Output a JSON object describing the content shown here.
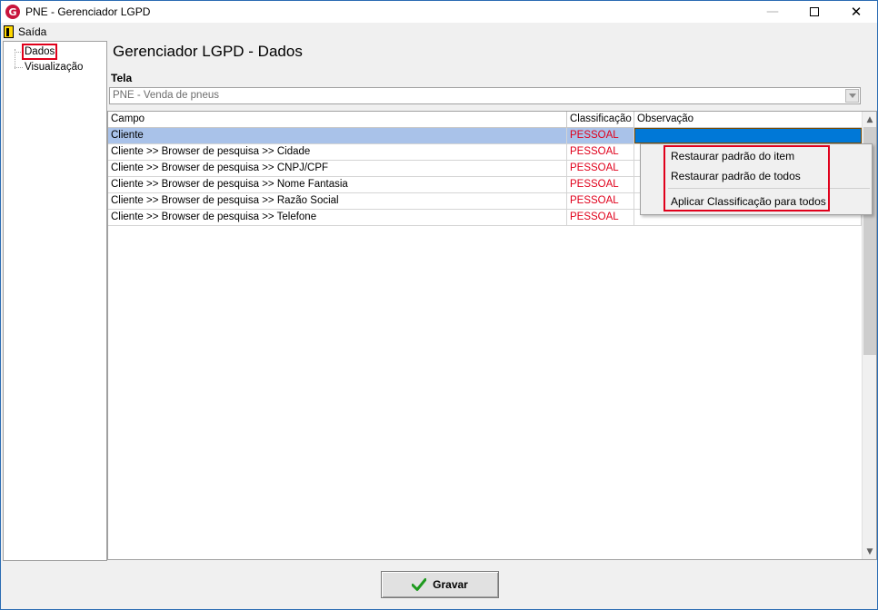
{
  "window": {
    "title": "PNE - Gerenciador LGPD",
    "app_icon_letter": "G",
    "minimize_glyph": "—",
    "close_glyph": "✕"
  },
  "menu": {
    "exit_label": "Saída"
  },
  "tree": {
    "items": [
      {
        "label": "Dados",
        "selected": true
      },
      {
        "label": "Visualização",
        "selected": false
      }
    ]
  },
  "main": {
    "title": "Gerenciador LGPD - Dados",
    "screen_label": "Tela",
    "screen_value": "PNE - Venda de pneus"
  },
  "grid": {
    "columns": [
      "Campo",
      "Classificação",
      "Observação"
    ],
    "rows": [
      {
        "field": "Cliente",
        "classification": "PESSOAL",
        "observation": ""
      },
      {
        "field": "Cliente >> Browser de pesquisa >> Cidade",
        "classification": "PESSOAL",
        "observation": ""
      },
      {
        "field": "Cliente >> Browser de pesquisa >> CNPJ/CPF",
        "classification": "PESSOAL",
        "observation": ""
      },
      {
        "field": "Cliente >> Browser de pesquisa >> Nome Fantasia",
        "classification": "PESSOAL",
        "observation": ""
      },
      {
        "field": "Cliente >> Browser de pesquisa >> Razão Social",
        "classification": "PESSOAL",
        "observation": ""
      },
      {
        "field": "Cliente >> Browser de pesquisa >> Telefone",
        "classification": "PESSOAL",
        "observation": ""
      }
    ],
    "scroll_up_glyph": "▲",
    "scroll_down_glyph": "▼"
  },
  "context_menu": {
    "items": [
      "Restaurar padrão do item",
      "Restaurar padrão de todos",
      "Aplicar Classificação para todos"
    ]
  },
  "footer": {
    "save_label": "Gravar"
  },
  "colors": {
    "accent": "#0078d7",
    "selected_row": "#a9c2e9",
    "classification_text": "#e0001b",
    "highlight_box": "#e0001b"
  },
  "icons": {
    "app": "app-logo-icon",
    "exit": "door-exit-icon",
    "save": "green-check-icon",
    "dropdown": "chevron-down-icon"
  }
}
